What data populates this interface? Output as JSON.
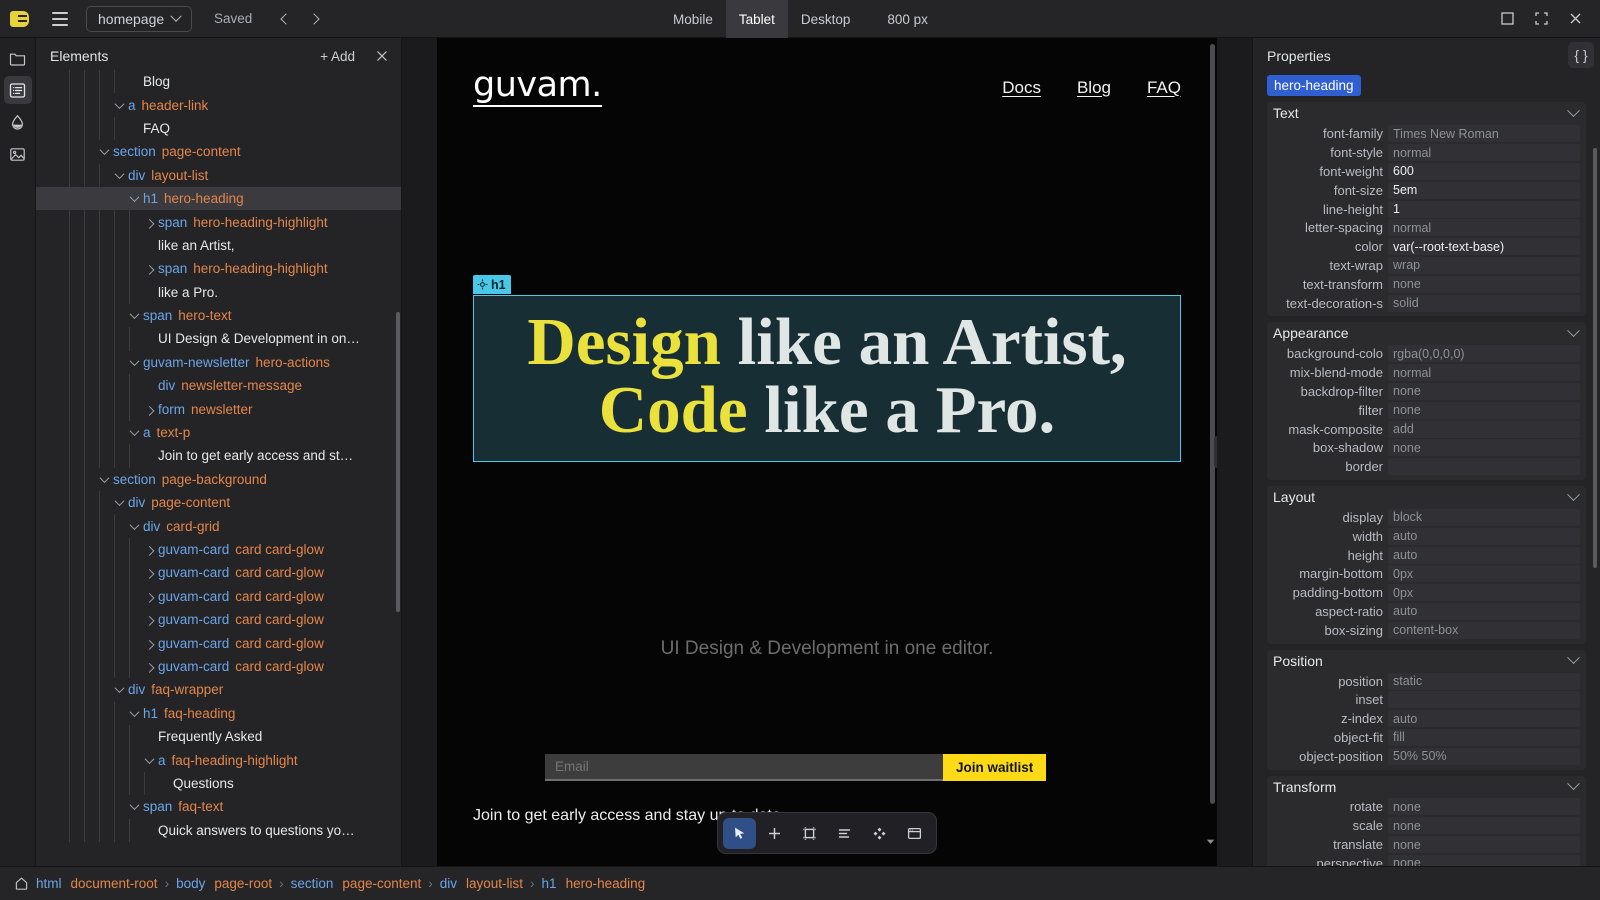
{
  "topbar": {
    "page_name": "homepage",
    "save_status": "Saved",
    "viewports": [
      {
        "label": "Mobile",
        "active": false
      },
      {
        "label": "Tablet",
        "active": true
      },
      {
        "label": "Desktop",
        "active": false
      }
    ],
    "viewport_size": "800 px"
  },
  "rail": [
    {
      "name": "folder-icon",
      "active": false
    },
    {
      "name": "layers-list-icon",
      "active": true
    },
    {
      "name": "droplet-icon",
      "active": false
    },
    {
      "name": "image-icon",
      "active": false
    }
  ],
  "elements_panel": {
    "title": "Elements",
    "add_label": "+ Add",
    "nodes": [
      {
        "depth": 5,
        "twisty": "none",
        "tag": "",
        "cls": "",
        "text": "Blog",
        "selected": false
      },
      {
        "depth": 4,
        "twisty": "open",
        "tag": "a",
        "cls": "header-link",
        "text": "",
        "selected": false
      },
      {
        "depth": 5,
        "twisty": "none",
        "tag": "",
        "cls": "",
        "text": "FAQ",
        "selected": false
      },
      {
        "depth": 3,
        "twisty": "open",
        "tag": "section",
        "cls": "page-content",
        "text": "",
        "selected": false
      },
      {
        "depth": 4,
        "twisty": "open",
        "tag": "div",
        "cls": "layout-list",
        "text": "",
        "selected": false
      },
      {
        "depth": 5,
        "twisty": "open",
        "tag": "h1",
        "cls": "hero-heading",
        "text": "",
        "selected": true
      },
      {
        "depth": 6,
        "twisty": "closed",
        "tag": "span",
        "cls": "hero-heading-highlight",
        "text": "",
        "selected": false
      },
      {
        "depth": 6,
        "twisty": "none",
        "tag": "",
        "cls": "",
        "text": "like an Artist,",
        "selected": false
      },
      {
        "depth": 6,
        "twisty": "closed",
        "tag": "span",
        "cls": "hero-heading-highlight",
        "text": "",
        "selected": false
      },
      {
        "depth": 6,
        "twisty": "none",
        "tag": "",
        "cls": "",
        "text": "like a Pro.",
        "selected": false
      },
      {
        "depth": 5,
        "twisty": "open",
        "tag": "span",
        "cls": "hero-text",
        "text": "",
        "selected": false
      },
      {
        "depth": 6,
        "twisty": "none",
        "tag": "",
        "cls": "",
        "text": "UI Design & Development in on…",
        "selected": false
      },
      {
        "depth": 5,
        "twisty": "open",
        "tag": "guvam-newsletter",
        "cls": "hero-actions",
        "text": "",
        "selected": false
      },
      {
        "depth": 6,
        "twisty": "none",
        "tag": "div",
        "cls": "newsletter-message",
        "text": "",
        "selected": false
      },
      {
        "depth": 6,
        "twisty": "closed",
        "tag": "form",
        "cls": "newsletter",
        "text": "",
        "selected": false
      },
      {
        "depth": 5,
        "twisty": "open",
        "tag": "a",
        "cls": "text-p",
        "text": "",
        "selected": false
      },
      {
        "depth": 6,
        "twisty": "none",
        "tag": "",
        "cls": "",
        "text": "Join to get early access and st…",
        "selected": false
      },
      {
        "depth": 3,
        "twisty": "open",
        "tag": "section",
        "cls": "page-background",
        "text": "",
        "selected": false
      },
      {
        "depth": 4,
        "twisty": "open",
        "tag": "div",
        "cls": "page-content",
        "text": "",
        "selected": false
      },
      {
        "depth": 5,
        "twisty": "open",
        "tag": "div",
        "cls": "card-grid",
        "text": "",
        "selected": false
      },
      {
        "depth": 6,
        "twisty": "closed",
        "tag": "guvam-card",
        "cls": "card card-glow",
        "text": "",
        "selected": false
      },
      {
        "depth": 6,
        "twisty": "closed",
        "tag": "guvam-card",
        "cls": "card card-glow",
        "text": "",
        "selected": false
      },
      {
        "depth": 6,
        "twisty": "closed",
        "tag": "guvam-card",
        "cls": "card card-glow",
        "text": "",
        "selected": false
      },
      {
        "depth": 6,
        "twisty": "closed",
        "tag": "guvam-card",
        "cls": "card card-glow",
        "text": "",
        "selected": false
      },
      {
        "depth": 6,
        "twisty": "closed",
        "tag": "guvam-card",
        "cls": "card card-glow",
        "text": "",
        "selected": false
      },
      {
        "depth": 6,
        "twisty": "closed",
        "tag": "guvam-card",
        "cls": "card card-glow",
        "text": "",
        "selected": false
      },
      {
        "depth": 4,
        "twisty": "open",
        "tag": "div",
        "cls": "faq-wrapper",
        "text": "",
        "selected": false
      },
      {
        "depth": 5,
        "twisty": "open",
        "tag": "h1",
        "cls": "faq-heading",
        "text": "",
        "selected": false
      },
      {
        "depth": 6,
        "twisty": "none",
        "tag": "",
        "cls": "",
        "text": "Frequently Asked",
        "selected": false
      },
      {
        "depth": 6,
        "twisty": "open",
        "tag": "a",
        "cls": "faq-heading-highlight",
        "text": "",
        "selected": false
      },
      {
        "depth": 7,
        "twisty": "none",
        "tag": "",
        "cls": "",
        "text": "Questions",
        "selected": false
      },
      {
        "depth": 5,
        "twisty": "open",
        "tag": "span",
        "cls": "faq-text",
        "text": "",
        "selected": false
      },
      {
        "depth": 6,
        "twisty": "none",
        "tag": "",
        "cls": "",
        "text": "Quick answers to questions yo…",
        "selected": false
      }
    ]
  },
  "canvas": {
    "brand": "guvam.",
    "nav": [
      "Docs",
      "Blog",
      "FAQ"
    ],
    "selection_badge": "h1",
    "hero": {
      "part1": "Design",
      "part2": " like an Artist, ",
      "part3": "Code",
      "part4": " like a Pro."
    },
    "subtitle": "UI Design & Development in one editor.",
    "email_placeholder": "Email",
    "email_value": "",
    "waitlist_button": "Join waitlist",
    "join_text": "Join to get early access and stay up to date",
    "tools": [
      {
        "name": "cursor-tool-icon",
        "active": true
      },
      {
        "name": "add-tool-icon",
        "active": false
      },
      {
        "name": "frame-tool-icon",
        "active": false
      },
      {
        "name": "text-align-tool-icon",
        "active": false
      },
      {
        "name": "components-tool-icon",
        "active": false
      },
      {
        "name": "window-tool-icon",
        "active": false
      }
    ]
  },
  "properties": {
    "title": "Properties",
    "selected_class": "hero-heading",
    "sections": [
      {
        "name": "Text",
        "rows": [
          {
            "label": "font-family",
            "value": "Times New Roman",
            "set": false
          },
          {
            "label": "font-style",
            "value": "normal",
            "set": false
          },
          {
            "label": "font-weight",
            "value": "600",
            "set": true
          },
          {
            "label": "font-size",
            "value": "5em",
            "set": true
          },
          {
            "label": "line-height",
            "value": "1",
            "set": true
          },
          {
            "label": "letter-spacing",
            "value": "normal",
            "set": false
          },
          {
            "label": "color",
            "value": "var(--root-text-base)",
            "set": true
          },
          {
            "label": "text-wrap",
            "value": "wrap",
            "set": false
          },
          {
            "label": "text-transform",
            "value": "none",
            "set": false
          },
          {
            "label": "text-decoration-s",
            "value": "solid",
            "set": false
          }
        ]
      },
      {
        "name": "Appearance",
        "rows": [
          {
            "label": "background-colo",
            "value": "rgba(0,0,0,0)",
            "set": false
          },
          {
            "label": "mix-blend-mode",
            "value": "normal",
            "set": false
          },
          {
            "label": "backdrop-filter",
            "value": "none",
            "set": false
          },
          {
            "label": "filter",
            "value": "none",
            "set": false
          },
          {
            "label": "mask-composite",
            "value": "add",
            "set": false
          },
          {
            "label": "box-shadow",
            "value": "none",
            "set": false
          },
          {
            "label": "border",
            "value": "",
            "set": false
          }
        ]
      },
      {
        "name": "Layout",
        "rows": [
          {
            "label": "display",
            "value": "block",
            "set": false
          },
          {
            "label": "width",
            "value": "auto",
            "set": false
          },
          {
            "label": "height",
            "value": "auto",
            "set": false
          },
          {
            "label": "margin-bottom",
            "value": "0px",
            "set": false
          },
          {
            "label": "padding-bottom",
            "value": "0px",
            "set": false
          },
          {
            "label": "aspect-ratio",
            "value": "auto",
            "set": false
          },
          {
            "label": "box-sizing",
            "value": "content-box",
            "set": false
          }
        ]
      },
      {
        "name": "Position",
        "rows": [
          {
            "label": "position",
            "value": "static",
            "set": false
          },
          {
            "label": "inset",
            "value": "",
            "set": false
          },
          {
            "label": "z-index",
            "value": "auto",
            "set": false
          },
          {
            "label": "object-fit",
            "value": "fill",
            "set": false
          },
          {
            "label": "object-position",
            "value": "50% 50%",
            "set": false
          }
        ]
      },
      {
        "name": "Transform",
        "rows": [
          {
            "label": "rotate",
            "value": "none",
            "set": false
          },
          {
            "label": "scale",
            "value": "none",
            "set": false
          },
          {
            "label": "translate",
            "value": "none",
            "set": false
          },
          {
            "label": "perspective",
            "value": "none",
            "set": false
          }
        ]
      }
    ]
  },
  "breadcrumb": [
    {
      "tag": "html",
      "cls": "document-root"
    },
    {
      "tag": "body",
      "cls": "page-root"
    },
    {
      "tag": "section",
      "cls": "page-content"
    },
    {
      "tag": "div",
      "cls": "layout-list"
    },
    {
      "tag": "h1",
      "cls": "hero-heading"
    }
  ]
}
